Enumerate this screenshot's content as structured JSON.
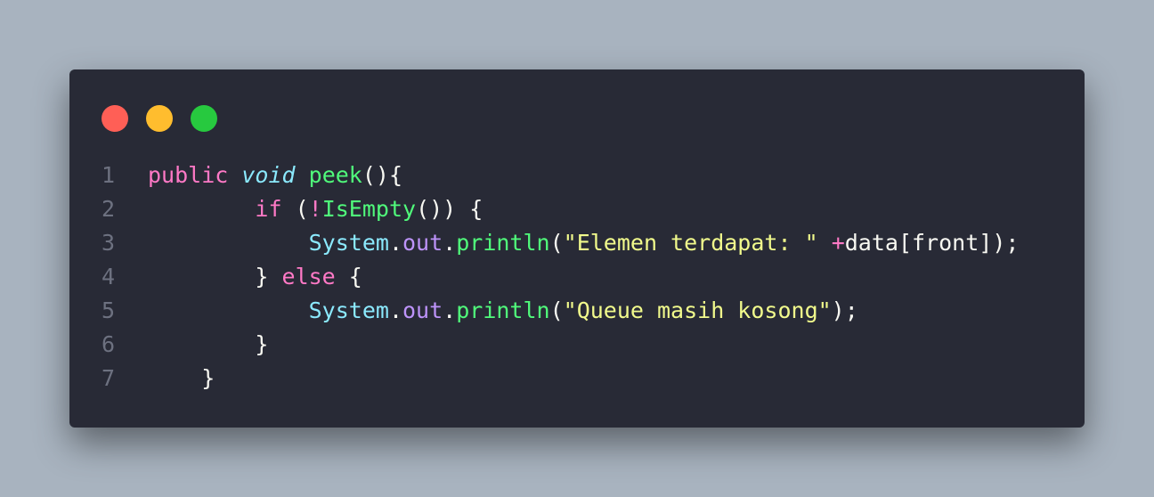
{
  "window": {
    "controls": [
      {
        "name": "close",
        "color": "#ff5f56"
      },
      {
        "name": "minimize",
        "color": "#ffbd2e"
      },
      {
        "name": "maximize",
        "color": "#27c93f"
      }
    ]
  },
  "code": {
    "lines": [
      {
        "number": "1",
        "indent": "",
        "tokens": [
          {
            "text": "public",
            "kind": "keyword"
          },
          {
            "text": " ",
            "kind": "plain"
          },
          {
            "text": "void",
            "kind": "type"
          },
          {
            "text": " ",
            "kind": "plain"
          },
          {
            "text": "peek",
            "kind": "func"
          },
          {
            "text": "(){",
            "kind": "plain"
          }
        ]
      },
      {
        "number": "2",
        "indent": "        ",
        "tokens": [
          {
            "text": "if",
            "kind": "keyword"
          },
          {
            "text": " (",
            "kind": "plain"
          },
          {
            "text": "!",
            "kind": "op"
          },
          {
            "text": "IsEmpty",
            "kind": "func"
          },
          {
            "text": "()) {",
            "kind": "plain"
          }
        ]
      },
      {
        "number": "3",
        "indent": "            ",
        "tokens": [
          {
            "text": "System",
            "kind": "class"
          },
          {
            "text": ".",
            "kind": "plain"
          },
          {
            "text": "out",
            "kind": "field"
          },
          {
            "text": ".",
            "kind": "plain"
          },
          {
            "text": "println",
            "kind": "func"
          },
          {
            "text": "(",
            "kind": "plain"
          },
          {
            "text": "\"Elemen terdapat: \"",
            "kind": "string"
          },
          {
            "text": " ",
            "kind": "plain"
          },
          {
            "text": "+",
            "kind": "op"
          },
          {
            "text": "data[front]);",
            "kind": "plain"
          }
        ]
      },
      {
        "number": "4",
        "indent": "        ",
        "tokens": [
          {
            "text": "} ",
            "kind": "plain"
          },
          {
            "text": "else",
            "kind": "keyword"
          },
          {
            "text": " {",
            "kind": "plain"
          }
        ]
      },
      {
        "number": "5",
        "indent": "            ",
        "tokens": [
          {
            "text": "System",
            "kind": "class"
          },
          {
            "text": ".",
            "kind": "plain"
          },
          {
            "text": "out",
            "kind": "field"
          },
          {
            "text": ".",
            "kind": "plain"
          },
          {
            "text": "println",
            "kind": "func"
          },
          {
            "text": "(",
            "kind": "plain"
          },
          {
            "text": "\"Queue masih kosong\"",
            "kind": "string"
          },
          {
            "text": ");",
            "kind": "plain"
          }
        ]
      },
      {
        "number": "6",
        "indent": "        ",
        "tokens": [
          {
            "text": "}",
            "kind": "plain"
          }
        ]
      },
      {
        "number": "7",
        "indent": "    ",
        "tokens": [
          {
            "text": "}",
            "kind": "plain"
          }
        ]
      }
    ]
  }
}
